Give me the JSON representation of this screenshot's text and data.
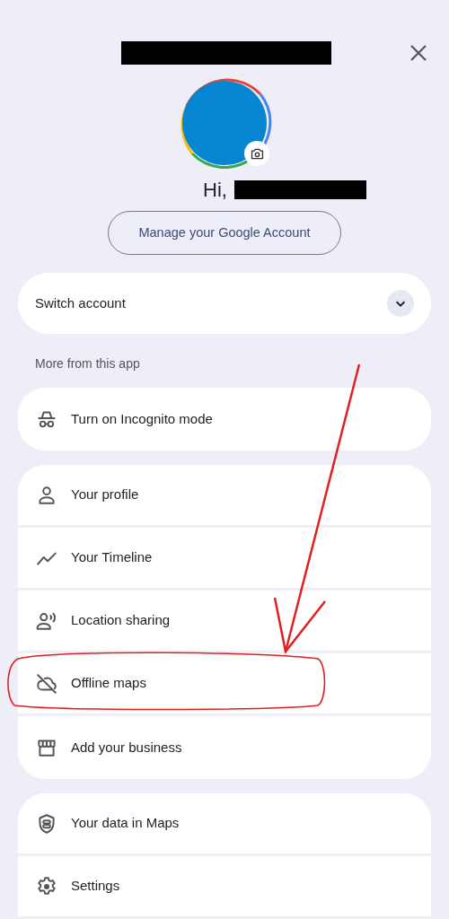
{
  "greeting": "Hi,",
  "manage_button": "Manage your Google Account",
  "switch_account": {
    "label": "Switch account",
    "expanded": false
  },
  "section_label": "More from this app",
  "groups": [
    {
      "items": [
        "Turn on Incognito mode"
      ]
    },
    {
      "items": [
        "Your profile",
        "Your Timeline",
        "Location sharing",
        "Offline maps",
        "Add your business"
      ]
    },
    {
      "items": [
        "Your data in Maps",
        "Settings"
      ]
    }
  ]
}
